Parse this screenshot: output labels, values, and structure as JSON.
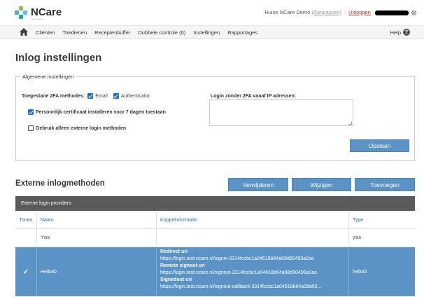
{
  "header": {
    "logo_text": "NCare",
    "logo_sub": "Zorgsoftware",
    "user_name": "Huize NCare Demo",
    "change_link": "(Aanpassen)",
    "separator": "|",
    "logout": "Uitloggen"
  },
  "nav": {
    "items": [
      "Cliënten",
      "Toedienen",
      "Receptenbuffer",
      "Dubbele controle (0)",
      "Instellingen",
      "Rapportages"
    ],
    "help_label": "Help",
    "help_icon": "?"
  },
  "page": {
    "title": "Inlog instellingen"
  },
  "settings": {
    "legend": "Algemene instellingen",
    "twofa_label": "Toegestane 2FA methodes:",
    "twofa_email": "Email",
    "twofa_email_checked": true,
    "twofa_auth": "Authenticator",
    "twofa_auth_checked": true,
    "cert_label": "Persoonlijk certificaat installeren voor 7 dagen toestaan",
    "cert_checked": true,
    "external_only_label": "Gebruik alleen externe login methoden",
    "external_only_checked": false,
    "ip_label": "Login zonder 2FA vanaf IP adressen:",
    "ip_value": "",
    "save_button": "Opslaan"
  },
  "external": {
    "title": "Externe inlogmethoden",
    "delete_button": "Verwijderen",
    "edit_button": "Wijzigen",
    "add_button": "Toevoegen",
    "table_title": "Externe login providers",
    "columns": [
      "Tonen",
      "Naam",
      "Koppelinformatie",
      "Type"
    ],
    "rows": [
      {
        "show": "",
        "name": "Ysis",
        "info": [],
        "type": "ysis"
      },
      {
        "show": "✓",
        "name": "HelloID",
        "info": [
          {
            "label": "Redirect uri",
            "value": "https://login.test.ncare.nl/signin-3314fccbc1a04618b64a08d90499a2ae"
          },
          {
            "label": "Remote signout uri",
            "value": "https://login.test.ncare.nl/signout-3314fccbc1a04618b64a08d90499a2ae"
          },
          {
            "label": "Signedout uri",
            "value": "https://login.test.ncare.nl/signout-callback-3314fccbc1a04618b64a08d90..."
          }
        ],
        "type": "helloid"
      }
    ]
  },
  "colors": {
    "accent": "#5b93c7",
    "table_header": "#5a5a5a",
    "logout": "#c0392b",
    "checkbox": "#1f6fd6"
  }
}
